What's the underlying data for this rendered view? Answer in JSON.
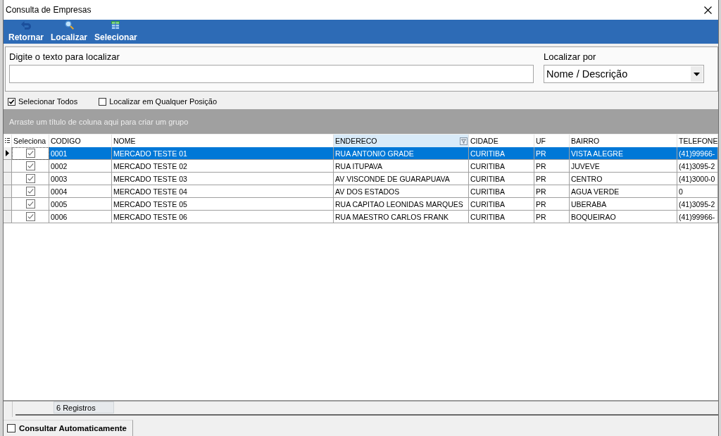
{
  "window": {
    "title": "Consulta de Empresas"
  },
  "toolbar": [
    {
      "kind": "back",
      "label": "Retornar"
    },
    {
      "kind": "search",
      "label": "Localizar"
    },
    {
      "kind": "select",
      "label": "Selecionar"
    }
  ],
  "search": {
    "label": "Digite o texto para localizar"
  },
  "search_by": {
    "label": "Localizar por",
    "value": "Nome / Descrição"
  },
  "options": [
    {
      "label": "Selecionar Todos",
      "checked": true
    },
    {
      "label": "Localizar em Qualquer Posição",
      "checked": false
    }
  ],
  "group_panel": {
    "hint": "Arraste um título de coluna aqui para criar um grupo"
  },
  "table": {
    "check_column": {
      "label": "Seleciona"
    },
    "columns": [
      {
        "label": "CODIGO",
        "highlighted": false
      },
      {
        "label": "NOME",
        "highlighted": false
      },
      {
        "label": "ENDERECO",
        "highlighted": true
      },
      {
        "label": "CIDADE",
        "highlighted": false
      },
      {
        "label": "UF",
        "highlighted": false
      },
      {
        "label": "BAIRRO",
        "highlighted": false
      },
      {
        "label": "TELEFONE",
        "highlighted": false
      }
    ],
    "rows": [
      {
        "selected": true,
        "checked": true,
        "cells": [
          "0001",
          "MERCADO TESTE 01",
          "RUA ANTONIO GRADE",
          "CURITIBA",
          "PR",
          "VISTA ALEGRE",
          "(41)99966-"
        ]
      },
      {
        "selected": false,
        "checked": true,
        "cells": [
          "0002",
          "MERCADO TESTE 02",
          "RUA ITUPAVA",
          "CURITIBA",
          "PR",
          "JUVEVE",
          "(41)3095-2"
        ]
      },
      {
        "selected": false,
        "checked": true,
        "cells": [
          "0003",
          "MERCADO TESTE 03",
          "AV VISCONDE DE GUARAPUAVA",
          "CURITIBA",
          "PR",
          "CENTRO",
          "(41)3000-0"
        ]
      },
      {
        "selected": false,
        "checked": true,
        "cells": [
          "0004",
          "MERCADO TESTE 04",
          "AV DOS ESTADOS",
          "CURITIBA",
          "PR",
          "AGUA VERDE",
          "0"
        ]
      },
      {
        "selected": false,
        "checked": true,
        "cells": [
          "0005",
          "MERCADO TESTE 05",
          "RUA CAPITAO LEONIDAS MARQUES",
          "CURITIBA",
          "PR",
          "UBERABA",
          "(41)3095-2"
        ]
      },
      {
        "selected": false,
        "checked": true,
        "cells": [
          "0006",
          "MERCADO TESTE 06",
          "RUA MAESTRO CARLOS FRANK",
          "CURITIBA",
          "PR",
          "BOQUEIRAO",
          "(41)99966-"
        ]
      }
    ]
  },
  "footer": {
    "count": "6 Registros"
  },
  "auto_query": {
    "label": "Consultar Automaticamente",
    "checked": false
  }
}
